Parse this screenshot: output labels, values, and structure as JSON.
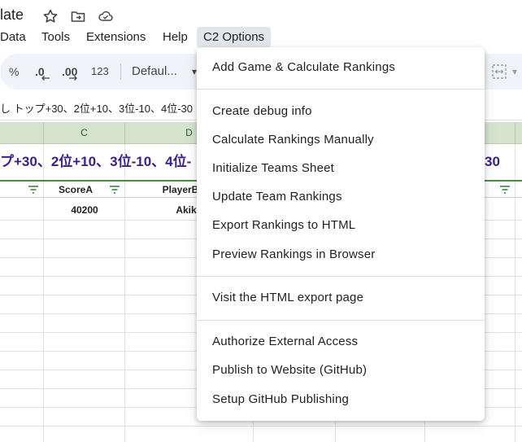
{
  "title": "late",
  "menubar": [
    "Data",
    "Tools",
    "Extensions",
    "Help",
    "C2 Options"
  ],
  "toolbar": {
    "percent": "%",
    "decrease_decimal": ".0",
    "increase_decimal": ".00",
    "number_format": "123",
    "font": "Defaul...",
    "font_caret": "▾"
  },
  "formula_text": "し トップ+30、2位+10、3位-10、4位-30",
  "columns": [
    "C",
    "D"
  ],
  "banner_text": "プ+30、2位+10、3位-10、4位-",
  "banner_right": "30",
  "headers": {
    "score_a": "ScoreA",
    "player_b": "PlayerB"
  },
  "row1": {
    "score_a": "40200",
    "player_b": "Akik"
  },
  "dropdown": {
    "groups": [
      [
        "Add Game & Calculate Rankings"
      ],
      [
        "Create debug info",
        "Calculate Rankings Manually",
        "Initialize Teams Sheet",
        "Update Team Rankings",
        "Export Rankings to HTML",
        "Preview Rankings in Browser"
      ],
      [
        "Visit the HTML export page"
      ],
      [
        "Authorize External Access",
        "Publish to Website (GitHub)",
        "Setup GitHub Publishing"
      ]
    ]
  },
  "colors": {
    "accent_menu_bg": "#e2e5e9",
    "toolbar_bg": "#f0f4f9",
    "col_header_bg": "#d3e3cd",
    "banner_text": "#3b1f8c",
    "header_border": "#4f8a4a"
  },
  "icons": [
    "star-icon",
    "move-to-folder-icon",
    "cloud-saved-icon",
    "filter-icon",
    "merge-cells-icon",
    "chevron-down-icon"
  ]
}
